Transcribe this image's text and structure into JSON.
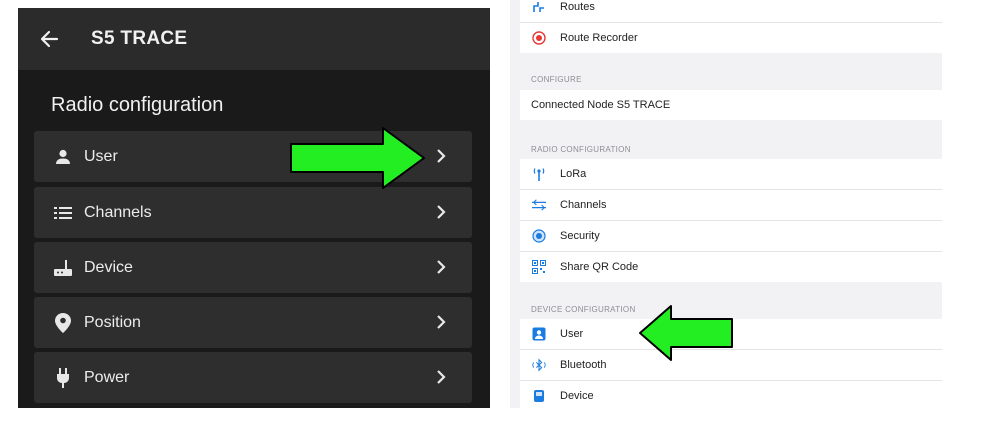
{
  "left": {
    "title": "S5 TRACE",
    "section": "Radio configuration",
    "items": [
      {
        "label": "User",
        "icon": "person-icon"
      },
      {
        "label": "Channels",
        "icon": "list-icon"
      },
      {
        "label": "Device",
        "icon": "router-icon"
      },
      {
        "label": "Position",
        "icon": "location-pin-icon"
      },
      {
        "label": "Power",
        "icon": "power-plug-icon"
      }
    ]
  },
  "right": {
    "top_items": [
      {
        "label": "Routes",
        "icon": "routes-icon"
      },
      {
        "label": "Route Recorder",
        "icon": "record-icon"
      }
    ],
    "configure": {
      "header": "CONFIGURE",
      "item": "Connected Node S5 TRACE"
    },
    "radio": {
      "header": "RADIO CONFIGURATION",
      "items": [
        {
          "label": "LoRa",
          "icon": "antenna-icon"
        },
        {
          "label": "Channels",
          "icon": "channels-icon"
        },
        {
          "label": "Security",
          "icon": "security-icon"
        },
        {
          "label": "Share QR Code",
          "icon": "qr-code-icon"
        }
      ]
    },
    "device": {
      "header": "DEVICE CONFIGURATION",
      "items": [
        {
          "label": "User",
          "icon": "user-card-icon"
        },
        {
          "label": "Bluetooth",
          "icon": "bluetooth-icon"
        },
        {
          "label": "Device",
          "icon": "device-icon"
        }
      ]
    }
  },
  "colors": {
    "arrow_green": "#22ee22",
    "ios_blue": "#1a7be0",
    "record_red": "#e53935"
  }
}
